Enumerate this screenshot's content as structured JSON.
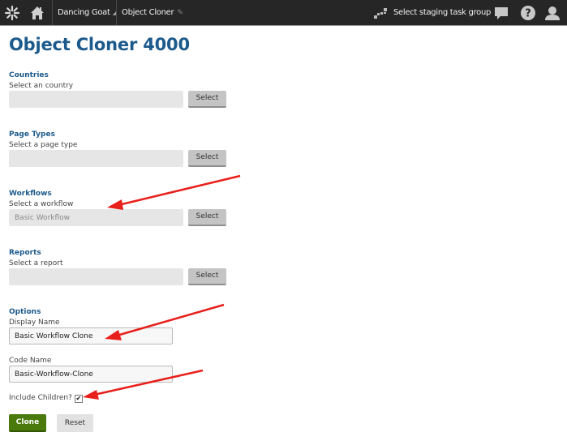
{
  "topbar": {
    "logo_icon": "kentico-logo-icon",
    "home_icon": "home-icon",
    "site_selector": "Dancing Goat",
    "app_name": "Object Cloner",
    "pin_icon": "pin-icon",
    "staging_icon": "staging-icon",
    "staging_label": "Select staging task group",
    "chat_icon": "chat-icon",
    "help_icon": "help-icon",
    "user_icon": "user-icon"
  },
  "page": {
    "title": "Object Cloner 4000"
  },
  "sections": {
    "countries": {
      "heading": "Countries",
      "label": "Select an country",
      "value": "",
      "button": "Select"
    },
    "page_types": {
      "heading": "Page Types",
      "label": "Select a page type",
      "value": "",
      "button": "Select"
    },
    "workflows": {
      "heading": "Workflows",
      "label": "Select a workflow",
      "value": "Basic Workflow",
      "button": "Select"
    },
    "reports": {
      "heading": "Reports",
      "label": "Select a report",
      "value": "",
      "button": "Select"
    }
  },
  "options": {
    "heading": "Options",
    "display_name_label": "Display Name",
    "display_name_value": "Basic Workflow Clone",
    "code_name_label": "Code Name",
    "code_name_value": "Basic-Workflow-Clone",
    "include_children_label": "Include Children?",
    "include_children_checked": true
  },
  "actions": {
    "clone": "Clone",
    "reset": "Reset"
  },
  "colors": {
    "topbar_bg": "#262626",
    "heading_blue": "#1c5a8c",
    "clone_green": "#4a7a0b",
    "annotation_red": "#e8201c"
  }
}
